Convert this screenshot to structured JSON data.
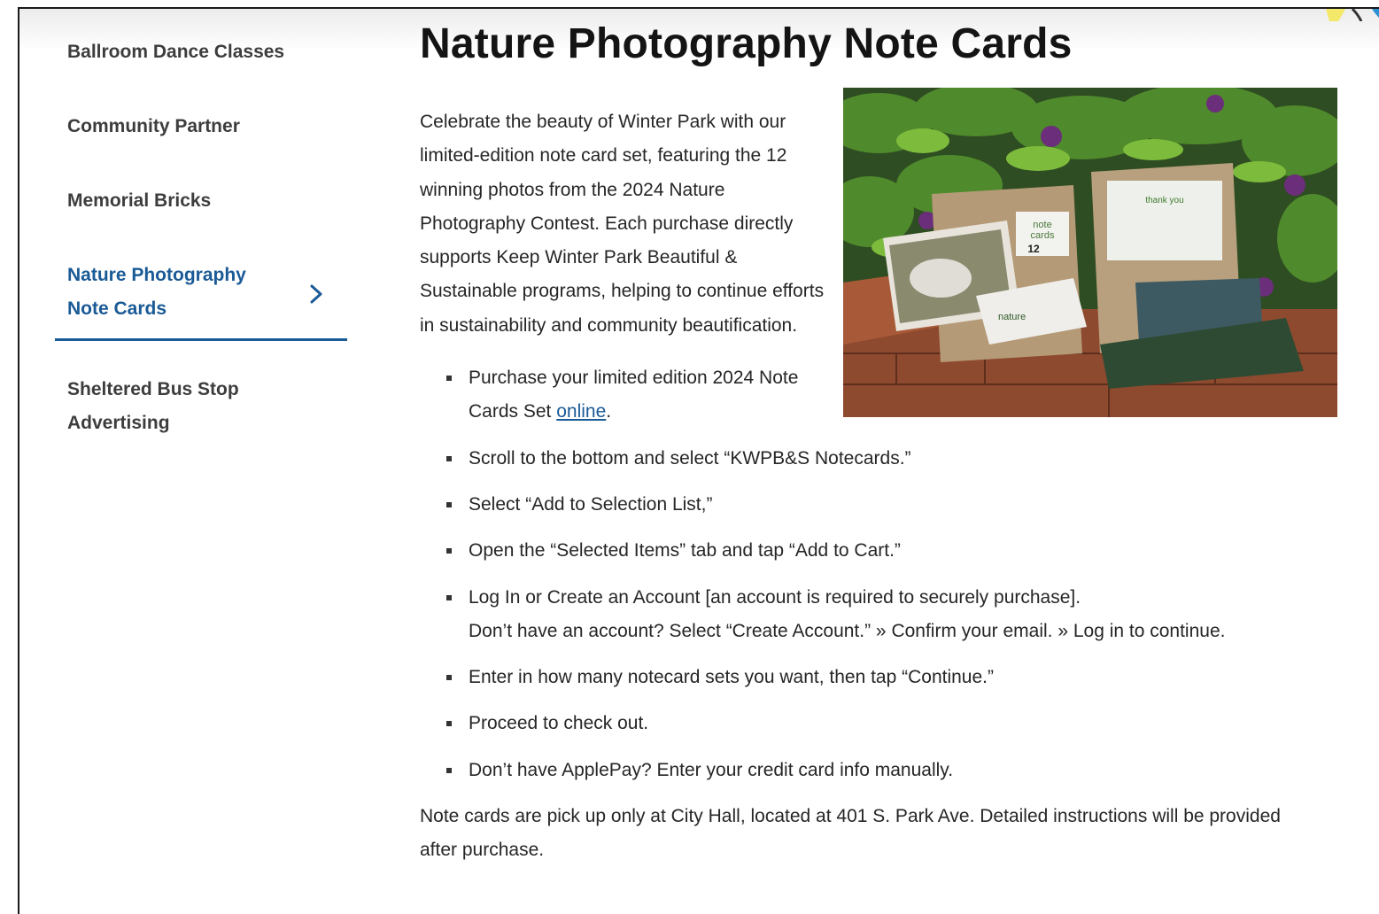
{
  "sidebar": {
    "items": [
      {
        "label": "Ballroom Dance Classes"
      },
      {
        "label": "Community Partner"
      },
      {
        "label": "Memorial Bricks"
      },
      {
        "label": "Nature Photography Note Cards",
        "active": true
      },
      {
        "label": "Sheltered Bus Stop Advertising"
      }
    ]
  },
  "main": {
    "title": "Nature Photography Note Cards",
    "intro": "Celebrate the beauty of Winter Park with our limited-edition note card set, featuring the 12 winning photos from the 2024 Nature Photography Contest. Each purchase directly supports Keep Winter Park Beautiful & Sustainable programs, helping to continue efforts in sustainability and community beautification.",
    "photo": {
      "thank_you": "thank you",
      "card_note": "note",
      "card_cards": "cards",
      "card_count": "12",
      "card_nature": "nature"
    },
    "steps": {
      "step1_prefix": "Purchase your limited edition 2024 Note Cards Set ",
      "step1_link": "online",
      "step1_suffix": ".",
      "step2": "Scroll to the bottom and select “KWPB&S Notecards.”",
      "step3": "Select “Add to Selection List,”",
      "step4": "Open the “Selected Items” tab and tap “Add to Cart.”",
      "step5_line1": "Log In or Create an Account [an account is required to securely purchase].",
      "step5_line2": "Don’t have an account? Select “Create Account.” » Confirm your email. » Log in to continue.",
      "step6": "Enter in how many notecard sets you want, then tap “Continue.”",
      "step7": "Proceed to check out.",
      "step8": "Don’t have ApplePay? Enter your credit card info manually."
    },
    "outro": "Note cards are pick up only at City Hall, located at 401 S. Park Ave. Detailed instructions will be provided after purchase."
  },
  "colors": {
    "accent": "#1a5a96",
    "text": "#262626",
    "nav_text": "#3d3d3d"
  }
}
